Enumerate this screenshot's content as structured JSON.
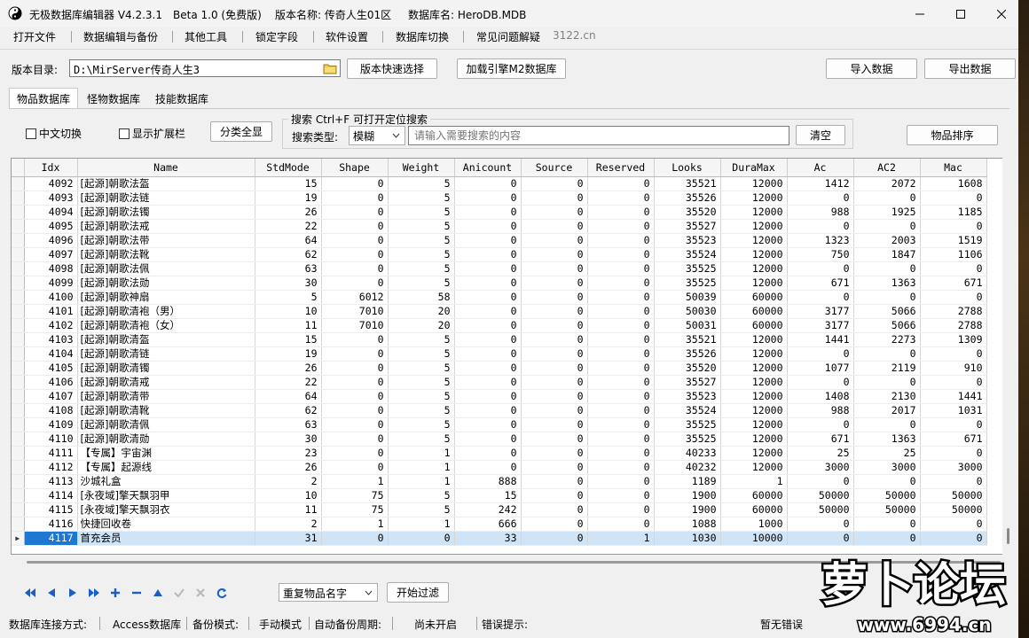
{
  "window": {
    "title_app": "无极数据库编辑器 V4.2.3.1",
    "title_beta": "Beta 1.0 (免费版)",
    "title_version": "版本名称: 传奇人生01区",
    "title_db": "数据库名: HeroDB.MDB"
  },
  "menu": {
    "items": [
      "打开文件",
      "数据编辑与备份",
      "其他工具",
      "锁定字段",
      "软件设置",
      "数据库切换",
      "常见问题解疑"
    ],
    "note": "3122.cn"
  },
  "toolbar": {
    "dir_label": "版本目录:",
    "dir_value": "D:\\MirServer传奇人生3",
    "quick_select": "版本快速选择",
    "load_engine": "加载引擎M2数据库",
    "import": "导入数据",
    "export": "导出数据"
  },
  "tabs": [
    "物品数据库",
    "怪物数据库",
    "技能数据库"
  ],
  "filters": {
    "chinese_toggle": "中文切换",
    "show_ext": "显示扩展栏",
    "category_all": "分类全显",
    "search_legend": "搜索   Ctrl+F 可打开定位搜索",
    "search_type_label": "搜索类型:",
    "search_type_value": "模糊",
    "search_placeholder": "请输入需要搜索的内容",
    "clear": "清空",
    "sort": "物品排序"
  },
  "grid": {
    "columns": [
      "Idx",
      "Name",
      "StdMode",
      "Shape",
      "Weight",
      "Anicount",
      "Source",
      "Reserved",
      "Looks",
      "DuraMax",
      "Ac",
      "AC2",
      "Mac"
    ],
    "rows": [
      [
        "4092",
        "[起源]朝歌法盔",
        "15",
        "0",
        "5",
        "0",
        "0",
        "0",
        "35521",
        "12000",
        "1412",
        "2072",
        "1608"
      ],
      [
        "4093",
        "[起源]朝歌法链",
        "19",
        "0",
        "5",
        "0",
        "0",
        "0",
        "35526",
        "12000",
        "0",
        "0",
        "0"
      ],
      [
        "4094",
        "[起源]朝歌法镯",
        "26",
        "0",
        "5",
        "0",
        "0",
        "0",
        "35520",
        "12000",
        "988",
        "1925",
        "1185"
      ],
      [
        "4095",
        "[起源]朝歌法戒",
        "22",
        "0",
        "5",
        "0",
        "0",
        "0",
        "35527",
        "12000",
        "0",
        "0",
        "0"
      ],
      [
        "4096",
        "[起源]朝歌法带",
        "64",
        "0",
        "5",
        "0",
        "0",
        "0",
        "35523",
        "12000",
        "1323",
        "2003",
        "1519"
      ],
      [
        "4097",
        "[起源]朝歌法靴",
        "62",
        "0",
        "5",
        "0",
        "0",
        "0",
        "35524",
        "12000",
        "750",
        "1847",
        "1106"
      ],
      [
        "4098",
        "[起源]朝歌法佩",
        "63",
        "0",
        "5",
        "0",
        "0",
        "0",
        "35525",
        "12000",
        "0",
        "0",
        "0"
      ],
      [
        "4099",
        "[起源]朝歌法勋",
        "30",
        "0",
        "5",
        "0",
        "0",
        "0",
        "35525",
        "12000",
        "671",
        "1363",
        "671"
      ],
      [
        "4100",
        "[起源]朝歌神扇",
        "5",
        "6012",
        "58",
        "0",
        "0",
        "0",
        "50039",
        "60000",
        "0",
        "0",
        "0"
      ],
      [
        "4101",
        "[起源]朝歌清袍（男）",
        "10",
        "7010",
        "20",
        "0",
        "0",
        "0",
        "50030",
        "60000",
        "3177",
        "5066",
        "2788"
      ],
      [
        "4102",
        "[起源]朝歌清袍（女）",
        "11",
        "7010",
        "20",
        "0",
        "0",
        "0",
        "50031",
        "60000",
        "3177",
        "5066",
        "2788"
      ],
      [
        "4103",
        "[起源]朝歌清盔",
        "15",
        "0",
        "5",
        "0",
        "0",
        "0",
        "35521",
        "12000",
        "1441",
        "2273",
        "1309"
      ],
      [
        "4104",
        "[起源]朝歌清链",
        "19",
        "0",
        "5",
        "0",
        "0",
        "0",
        "35526",
        "12000",
        "0",
        "0",
        "0"
      ],
      [
        "4105",
        "[起源]朝歌清镯",
        "26",
        "0",
        "5",
        "0",
        "0",
        "0",
        "35520",
        "12000",
        "1077",
        "2119",
        "910"
      ],
      [
        "4106",
        "[起源]朝歌清戒",
        "22",
        "0",
        "5",
        "0",
        "0",
        "0",
        "35527",
        "12000",
        "0",
        "0",
        "0"
      ],
      [
        "4107",
        "[起源]朝歌清带",
        "64",
        "0",
        "5",
        "0",
        "0",
        "0",
        "35523",
        "12000",
        "1408",
        "2130",
        "1441"
      ],
      [
        "4108",
        "[起源]朝歌清靴",
        "62",
        "0",
        "5",
        "0",
        "0",
        "0",
        "35524",
        "12000",
        "988",
        "2017",
        "1031"
      ],
      [
        "4109",
        "[起源]朝歌清佩",
        "63",
        "0",
        "5",
        "0",
        "0",
        "0",
        "35525",
        "12000",
        "0",
        "0",
        "0"
      ],
      [
        "4110",
        "[起源]朝歌清勋",
        "30",
        "0",
        "5",
        "0",
        "0",
        "0",
        "35525",
        "12000",
        "671",
        "1363",
        "671"
      ],
      [
        "4111",
        "【专属】宇宙渊",
        "23",
        "0",
        "1",
        "0",
        "0",
        "0",
        "40233",
        "12000",
        "25",
        "25",
        "0"
      ],
      [
        "4112",
        "【专属】起源线",
        "26",
        "0",
        "1",
        "0",
        "0",
        "0",
        "40232",
        "12000",
        "3000",
        "3000",
        "3000"
      ],
      [
        "4113",
        "沙城礼盒",
        "2",
        "1",
        "1",
        "888",
        "0",
        "0",
        "1189",
        "1",
        "0",
        "0",
        "0"
      ],
      [
        "4114",
        "[永夜域]擎天飘羽甲",
        "10",
        "75",
        "5",
        "15",
        "0",
        "0",
        "1900",
        "60000",
        "50000",
        "50000",
        "50000"
      ],
      [
        "4115",
        "[永夜域]擎天飘羽衣",
        "11",
        "75",
        "5",
        "242",
        "0",
        "0",
        "1900",
        "60000",
        "50000",
        "50000",
        "50000"
      ],
      [
        "4116",
        "快捷回收卷",
        "2",
        "1",
        "1",
        "666",
        "0",
        "0",
        "1088",
        "1000",
        "0",
        "0",
        "0"
      ],
      [
        "4117",
        "首充会员",
        "31",
        "0",
        "0",
        "33",
        "0",
        "1",
        "1030",
        "10000",
        "0",
        "0",
        "0"
      ]
    ],
    "selected_index": 25
  },
  "bottom": {
    "filter_value": "重复物品名字",
    "start_filter": "开始过滤"
  },
  "status": {
    "conn_label": "数据库连接方式:",
    "conn_value": "Access数据库",
    "backup_label": "备份模式:",
    "backup_value": "手动模式",
    "auto_label": "自动备份周期:",
    "auto_value": "尚未开启",
    "err_label": "错误提示:",
    "err_value": "暂无错误"
  },
  "watermark": {
    "brand": "萝卜论坛",
    "url": "www.6994.cn"
  }
}
